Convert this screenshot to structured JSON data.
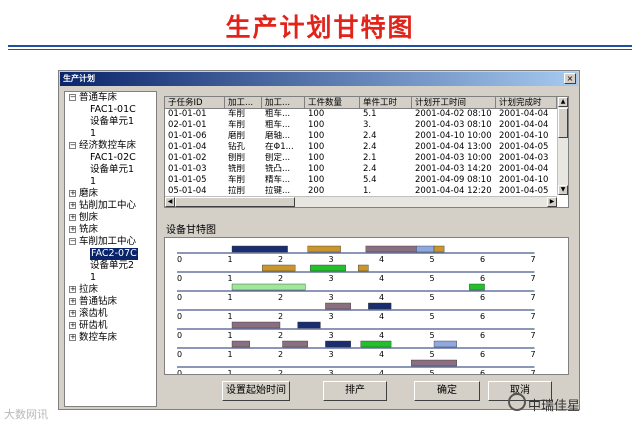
{
  "slide": {
    "title": "生产计划甘特图"
  },
  "window": {
    "title": "生产计划",
    "close_glyph": "×"
  },
  "tree": [
    {
      "label": "普通车床",
      "indent": 0,
      "toggle": "−"
    },
    {
      "label": "FAC1-01C",
      "indent": 2
    },
    {
      "label": "设备单元1",
      "indent": 2
    },
    {
      "label": "1",
      "indent": 2
    },
    {
      "label": "经济数控车床",
      "indent": 0,
      "toggle": "−"
    },
    {
      "label": "FAC1-02C",
      "indent": 2
    },
    {
      "label": "设备单元1",
      "indent": 2
    },
    {
      "label": "1",
      "indent": 2
    },
    {
      "label": "磨床",
      "indent": 0,
      "toggle": "+"
    },
    {
      "label": "钻削加工中心",
      "indent": 0,
      "toggle": "+"
    },
    {
      "label": "刨床",
      "indent": 0,
      "toggle": "+"
    },
    {
      "label": "铣床",
      "indent": 0,
      "toggle": "+"
    },
    {
      "label": "车削加工中心",
      "indent": 0,
      "toggle": "−"
    },
    {
      "label": "FAC2-07C",
      "indent": 2,
      "selected": true
    },
    {
      "label": "设备单元2",
      "indent": 2
    },
    {
      "label": "1",
      "indent": 2
    },
    {
      "label": "拉床",
      "indent": 0,
      "toggle": "+"
    },
    {
      "label": "普通钻床",
      "indent": 0,
      "toggle": "+"
    },
    {
      "label": "滚齿机",
      "indent": 0,
      "toggle": "+"
    },
    {
      "label": "研齿机",
      "indent": 0,
      "toggle": "+"
    },
    {
      "label": "数控车床",
      "indent": 0,
      "toggle": "+"
    }
  ],
  "table": {
    "columns": [
      "子任务ID",
      "加工...",
      "加工...",
      "工件数量",
      "单件工时",
      "计划开工时间",
      "计划完成时"
    ],
    "rows": [
      [
        "01-01-01",
        "车削",
        "粗车...",
        "100",
        "5.1",
        "2001-04-02 08:10",
        "2001-04-04"
      ],
      [
        "02-01-01",
        "车削",
        "粗车...",
        "100",
        "3.",
        "2001-04-03 08:10",
        "2001-04-04"
      ],
      [
        "01-01-06",
        "磨削",
        "磨轴...",
        "100",
        "2.4",
        "2001-04-10 10:00",
        "2001-04-10"
      ],
      [
        "01-01-04",
        "钻孔",
        "在Φ1...",
        "100",
        "2.4",
        "2001-04-04 13:00",
        "2001-04-05"
      ],
      [
        "01-01-02",
        "刨削",
        "刨定...",
        "100",
        "2.1",
        "2001-04-03 10:00",
        "2001-04-03"
      ],
      [
        "01-01-03",
        "铣削",
        "铣凸...",
        "100",
        "2.4",
        "2001-04-03 14:20",
        "2001-04-04"
      ],
      [
        "01-01-05",
        "车削",
        "精车...",
        "100",
        "5.4",
        "2001-04-09 08:10",
        "2001-04-10"
      ],
      [
        "05-01-04",
        "拉削",
        "拉键...",
        "200",
        "1.",
        "2001-04-04 12:20",
        "2001-04-05"
      ]
    ]
  },
  "gantt": {
    "label": "设备甘特图",
    "ticks": [
      "0",
      "1",
      "2",
      "3",
      "4",
      "5",
      "6",
      "7"
    ],
    "bars": [
      {
        "row": 0,
        "start": 1.05,
        "end": 2.15,
        "color": "#1a2d6e"
      },
      {
        "row": 0,
        "start": 2.55,
        "end": 3.2,
        "color": "#c8962c"
      },
      {
        "row": 0,
        "start": 3.7,
        "end": 4.7,
        "color": "#8a6f80"
      },
      {
        "row": 0,
        "start": 4.7,
        "end": 5.05,
        "color": "#8fa8e0"
      },
      {
        "row": 0,
        "start": 5.05,
        "end": 5.25,
        "color": "#c8962c"
      },
      {
        "row": 1,
        "start": 1.65,
        "end": 2.3,
        "color": "#c8962c"
      },
      {
        "row": 1,
        "start": 2.6,
        "end": 3.3,
        "color": "#22c02a"
      },
      {
        "row": 1,
        "start": 3.55,
        "end": 3.75,
        "color": "#c8962c"
      },
      {
        "row": 2,
        "start": 1.05,
        "end": 2.5,
        "color": "#9ee89a"
      },
      {
        "row": 2,
        "start": 5.75,
        "end": 6.05,
        "color": "#22c02a"
      },
      {
        "row": 3,
        "start": 2.9,
        "end": 3.4,
        "color": "#8a6f80"
      },
      {
        "row": 3,
        "start": 3.75,
        "end": 4.2,
        "color": "#1a2d6e"
      },
      {
        "row": 4,
        "start": 1.05,
        "end": 2.0,
        "color": "#8a6f80"
      },
      {
        "row": 4,
        "start": 2.35,
        "end": 2.8,
        "color": "#1a2d6e"
      },
      {
        "row": 5,
        "start": 1.05,
        "end": 1.4,
        "color": "#8a6f80"
      },
      {
        "row": 5,
        "start": 2.05,
        "end": 2.55,
        "color": "#8a6f80"
      },
      {
        "row": 5,
        "start": 2.9,
        "end": 3.4,
        "color": "#1a2d6e"
      },
      {
        "row": 5,
        "start": 3.6,
        "end": 4.2,
        "color": "#22c02a"
      },
      {
        "row": 5,
        "start": 5.05,
        "end": 5.5,
        "color": "#8fa8e0"
      },
      {
        "row": 6,
        "start": 4.6,
        "end": 5.5,
        "color": "#8a6f80"
      }
    ]
  },
  "buttons": {
    "set_start": "设置起始时间",
    "schedule": "排产",
    "ok": "确定",
    "cancel": "取消"
  },
  "watermarks": {
    "left": "大数网讯",
    "right": "中瑞佳星"
  }
}
